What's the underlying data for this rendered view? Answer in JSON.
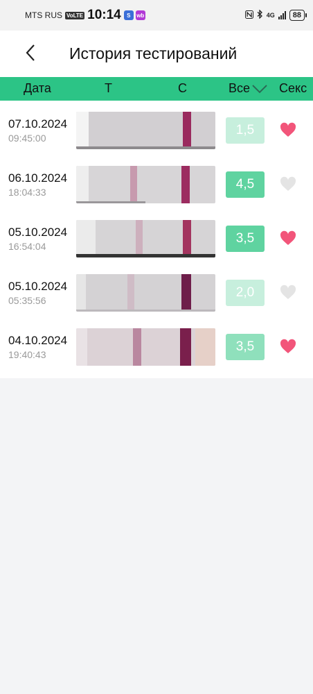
{
  "status": {
    "carrier": "MTS RUS",
    "volte": "VoLTE",
    "time": "10:14",
    "app1": "S",
    "app2": "wb",
    "network": "4G",
    "battery": "88"
  },
  "header": {
    "title": "История тестирований"
  },
  "columns": {
    "date": "Дата",
    "t": "Т",
    "c": "С",
    "all": "Все",
    "sex": "Секс"
  },
  "rows": [
    {
      "date": "07.10.2024",
      "time": "09:45:00",
      "score": "1,5",
      "sex": true
    },
    {
      "date": "06.10.2024",
      "time": "18:04:33",
      "score": "4,5",
      "sex": false
    },
    {
      "date": "05.10.2024",
      "time": "16:54:04",
      "score": "3,5",
      "sex": true
    },
    {
      "date": "05.10.2024",
      "time": "05:35:56",
      "score": "2,0",
      "sex": false
    },
    {
      "date": "04.10.2024",
      "time": "19:40:43",
      "score": "3,5",
      "sex": true
    }
  ],
  "colors": {
    "accent": "#2cc486",
    "heart_active": "#f2557a",
    "heart_inactive": "#e4e4e4"
  }
}
